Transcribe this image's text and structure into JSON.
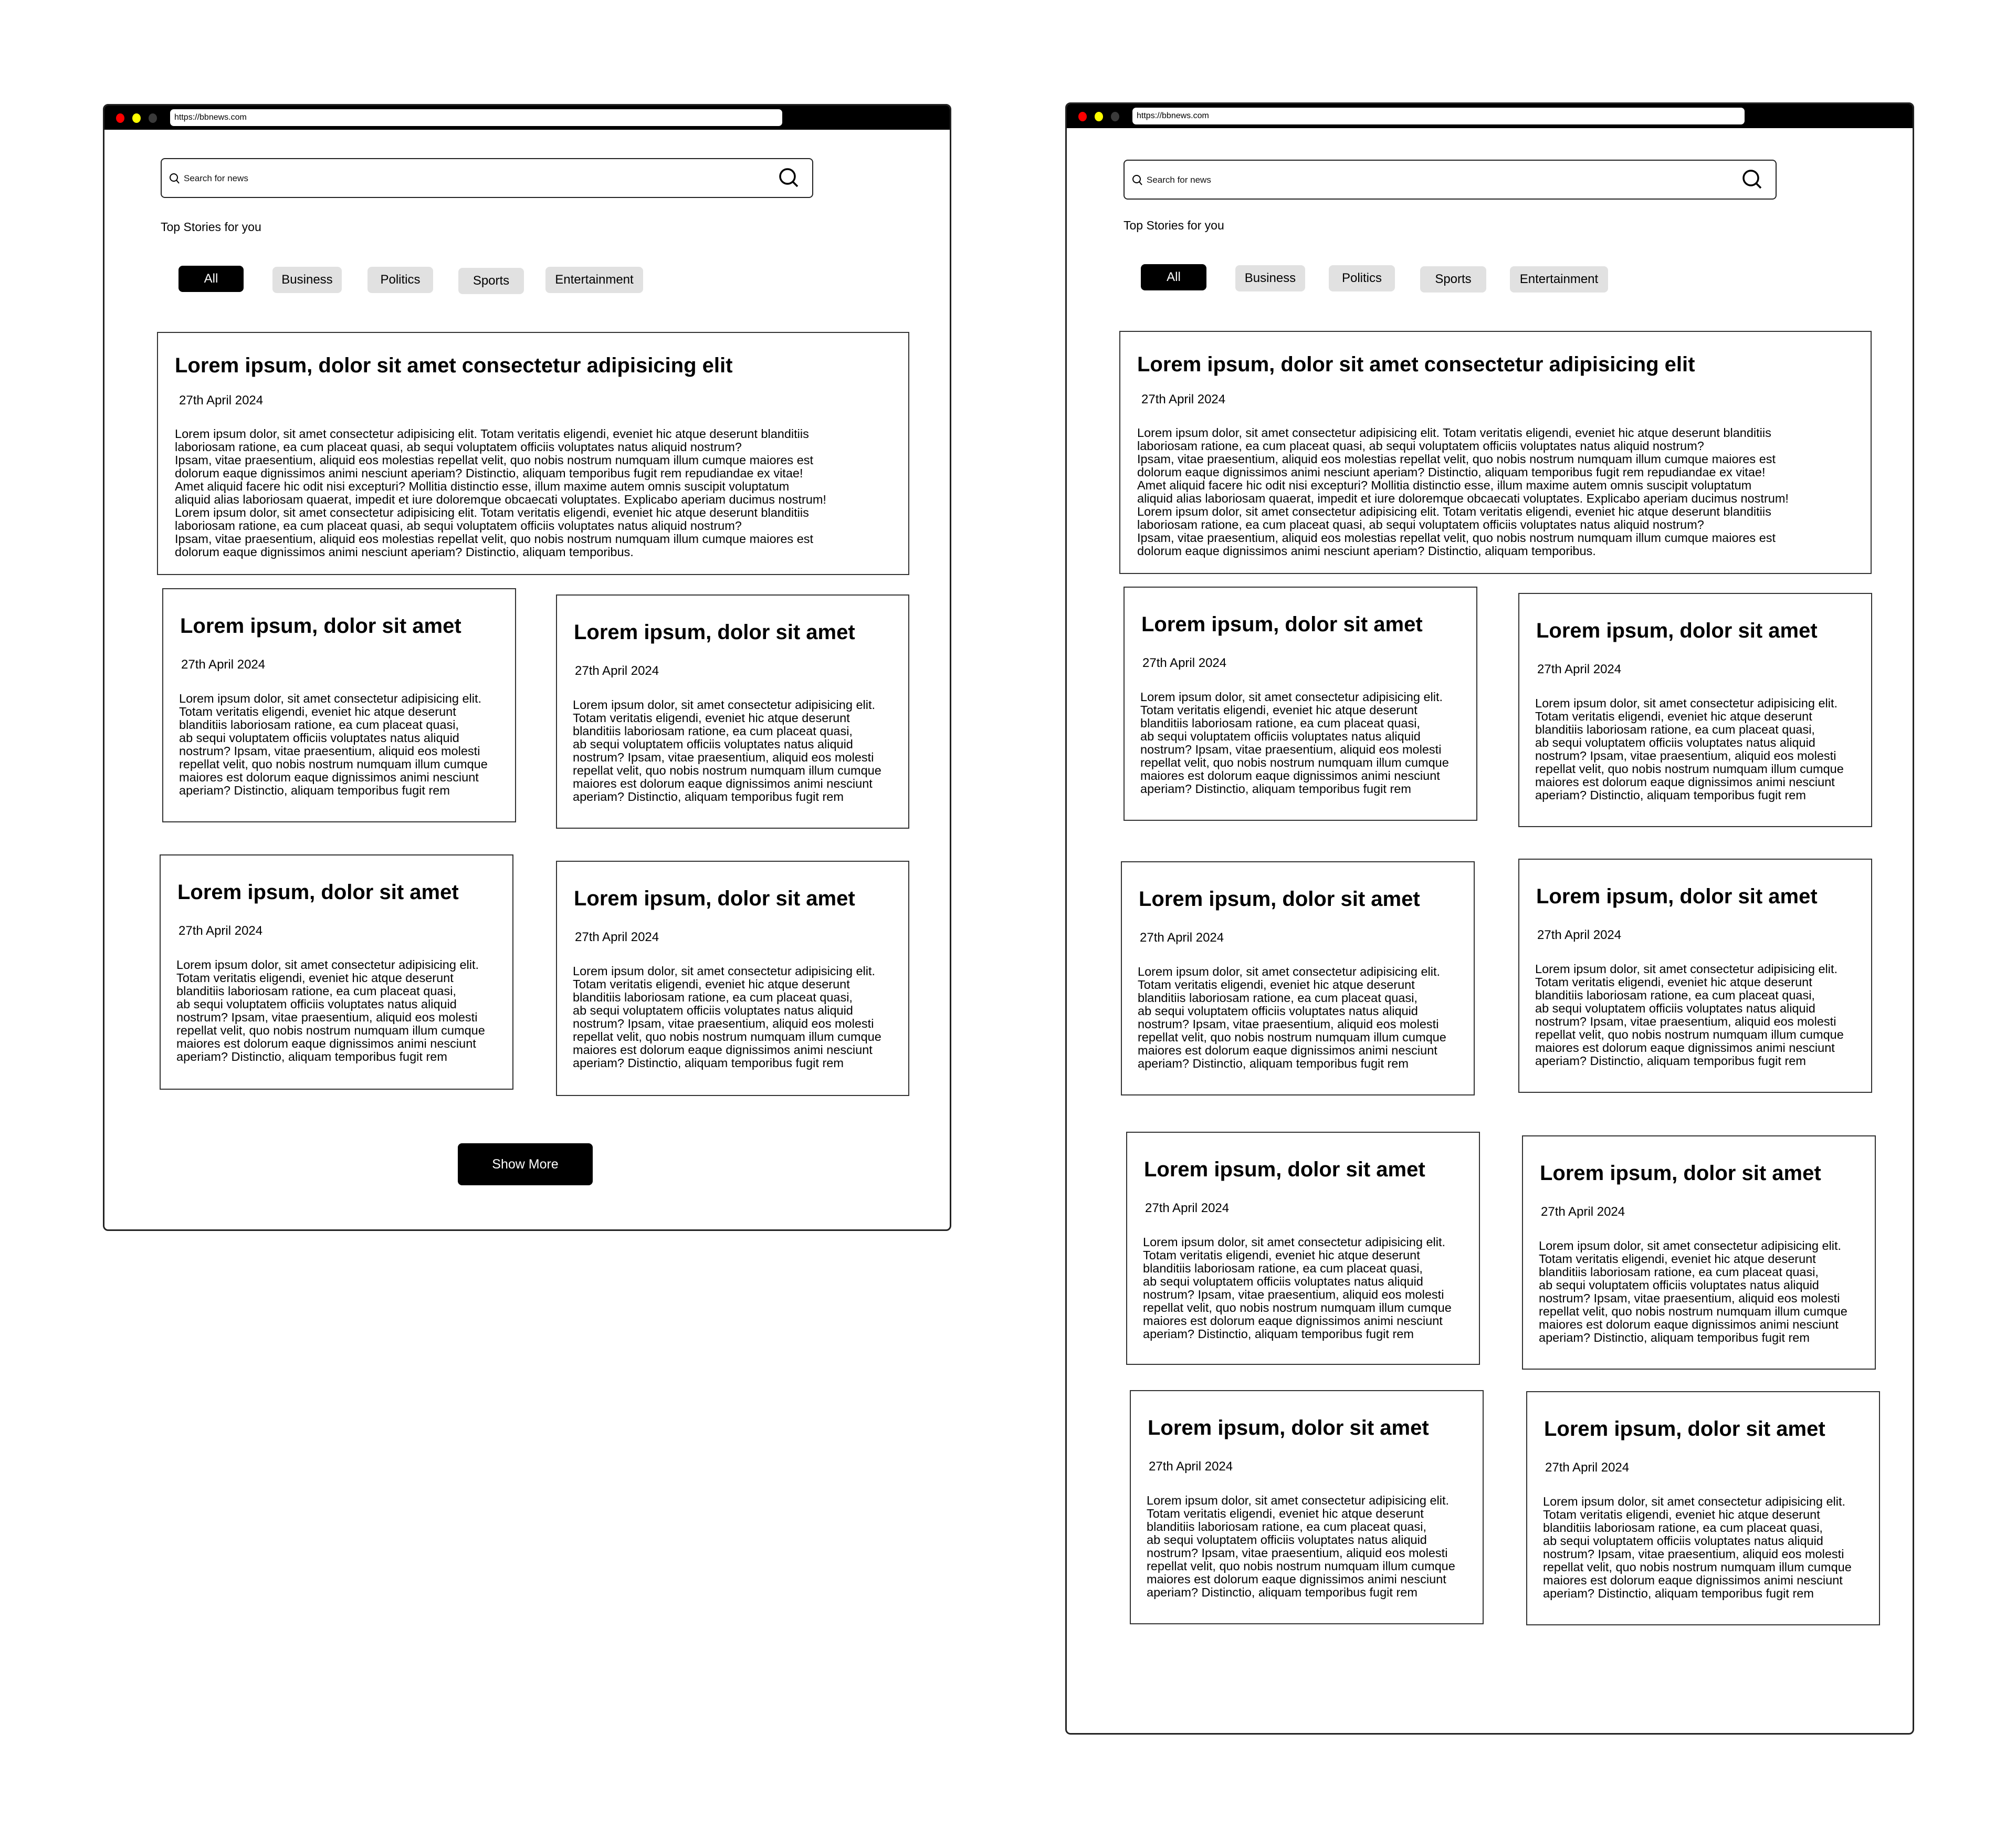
{
  "browser": {
    "url": "https://bbnews.com",
    "window_controls": [
      "close-dot",
      "minimize-dot",
      "maximize-dot"
    ],
    "control_colors": {
      "close": "#ff0000",
      "minimize": "#ffff00",
      "maximize": "#3a3a3a"
    }
  },
  "search": {
    "placeholder": "Search for news",
    "icon": "search-icon"
  },
  "section_title": "Top Stories for you",
  "categories": [
    {
      "label": "All",
      "active": true
    },
    {
      "label": "Business",
      "active": false
    },
    {
      "label": "Politics",
      "active": false
    },
    {
      "label": "Sports",
      "active": false
    },
    {
      "label": "Entertainment",
      "active": false
    }
  ],
  "featured": {
    "title": "Lorem ipsum, dolor sit amet consectetur adipisicing elit",
    "date": "27th April 2024",
    "body": "Lorem ipsum dolor, sit amet consectetur adipisicing elit. Totam veritatis eligendi, eveniet hic atque deserunt blanditiis\n laboriosam ratione, ea cum placeat quasi, ab sequi voluptatem officiis voluptates natus aliquid nostrum?\nIpsam, vitae praesentium, aliquid eos molestias repellat velit, quo nobis nostrum numquam illum cumque maiores est\ndolorum eaque dignissimos animi nesciunt aperiam? Distinctio, aliquam temporibus fugit rem repudiandae ex vitae!\nAmet aliquid facere hic odit nisi excepturi? Mollitia distinctio esse, illum maxime autem omnis suscipit voluptatum\naliquid alias laboriosam quaerat, impedit et iure doloremque obcaecati voluptates. Explicabo aperiam ducimus nostrum!\nLorem ipsum dolor, sit amet consectetur adipisicing elit. Totam veritatis eligendi, eveniet hic atque deserunt blanditiis\n laboriosam ratione, ea cum placeat quasi, ab sequi voluptatem officiis voluptates natus aliquid nostrum?\nIpsam, vitae praesentium, aliquid eos molestias repellat velit, quo nobis nostrum numquam illum cumque maiores est\ndolorum eaque dignissimos animi nesciunt aperiam? Distinctio, aliquam temporibus."
  },
  "article": {
    "title": "Lorem ipsum, dolor sit amet",
    "date": "27th April 2024",
    "body": "Lorem ipsum dolor, sit amet consectetur adipisicing elit.\n Totam veritatis eligendi, eveniet hic atque deserunt\nblanditiis laboriosam ratione, ea cum placeat quasi,\nab sequi voluptatem officiis voluptates natus aliquid\nnostrum? Ipsam, vitae praesentium, aliquid eos molesti\nrepellat velit, quo nobis nostrum numquam illum cumque\nmaiores est dolorum eaque dignissimos animi nesciunt\naperiam? Distinctio, aliquam temporibus fugit rem"
  },
  "left_window": {
    "article_card_count": 4,
    "show_more_label": "Show More"
  },
  "right_window": {
    "article_card_count": 8
  }
}
